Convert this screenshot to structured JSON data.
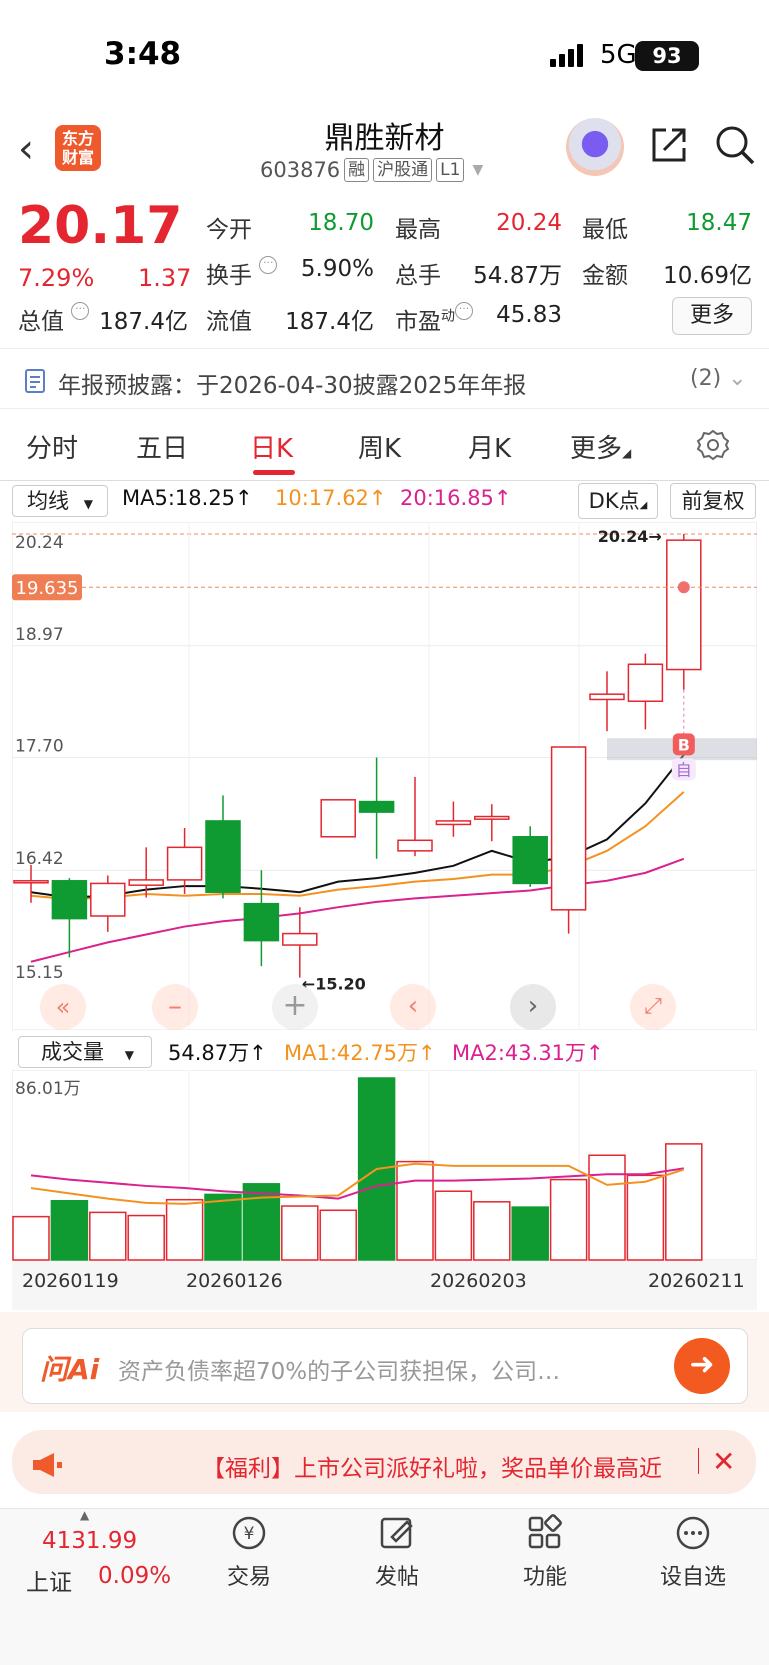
{
  "status": {
    "time": "3:48",
    "network": "5G",
    "battery": "93"
  },
  "header": {
    "logo_top": "东方",
    "logo_bottom": "财富",
    "name": "鼎胜新材",
    "code": "603876",
    "tags": [
      "融",
      "沪股通",
      "L1"
    ]
  },
  "quote": {
    "price": "20.17",
    "pct": "7.29%",
    "change": "1.37",
    "fields": [
      {
        "k": "今开",
        "v": "18.70",
        "c": "green"
      },
      {
        "k": "最高",
        "v": "20.24",
        "c": "red"
      },
      {
        "k": "最低",
        "v": "18.47",
        "c": "green"
      },
      {
        "k": "换手",
        "v": "5.90%",
        "c": "dark"
      },
      {
        "k": "总手",
        "v": "54.87万",
        "c": "dark"
      },
      {
        "k": "金额",
        "v": "10.69亿",
        "c": "dark"
      },
      {
        "k": "总值",
        "v": "187.4亿",
        "c": "dark"
      },
      {
        "k": "流值",
        "v": "187.4亿",
        "c": "dark"
      },
      {
        "k": "市盈",
        "v": "45.83",
        "c": "dark"
      }
    ],
    "pe_sup": "动",
    "more": "更多"
  },
  "notice": {
    "text": "年报预披露：于2026-04-30披露2025年年报",
    "count": "(2)"
  },
  "tabs": [
    "分时",
    "五日",
    "日K",
    "周K",
    "月K",
    "更多"
  ],
  "active_tab": 2,
  "ma_row": {
    "select": "均线",
    "ma5": "MA5:18.25↑",
    "ma10": "10:17.62↑",
    "ma20": "20:16.85↑",
    "dk": "DK点",
    "fq": "前复权"
  },
  "price_axis": [
    "20.24",
    "18.97",
    "17.70",
    "16.42",
    "15.15"
  ],
  "crosshair": "19.635",
  "high_label": "20.24→",
  "low_label": "←15.20",
  "b_label": "B",
  "self_label": "自",
  "vol_row": {
    "select": "成交量",
    "vol": "54.87万↑",
    "ma1": "MA1:42.75万↑",
    "ma2": "MA2:43.31万↑",
    "axis_max": "86.01万"
  },
  "dates": [
    "20260119",
    "20260126",
    "20260203",
    "20260211"
  ],
  "colors": {
    "up": "#e3262f",
    "down": "#0f9b32",
    "ma5": "#111111",
    "ma10": "#f39220",
    "ma20": "#d9218f"
  },
  "chart_data": {
    "type": "candlestick",
    "ylim": [
      15.15,
      20.24
    ],
    "candles": [
      {
        "o": 16.3,
        "c": 16.3,
        "h": 16.48,
        "l": 16.05
      },
      {
        "o": 16.3,
        "c": 15.87,
        "h": 16.33,
        "l": 15.43
      },
      {
        "o": 15.9,
        "c": 16.27,
        "h": 16.36,
        "l": 15.72
      },
      {
        "o": 16.25,
        "c": 16.31,
        "h": 16.68,
        "l": 16.11
      },
      {
        "o": 16.31,
        "c": 16.68,
        "h": 16.9,
        "l": 16.15
      },
      {
        "o": 16.98,
        "c": 16.17,
        "h": 17.27,
        "l": 16.1
      },
      {
        "o": 16.04,
        "c": 15.62,
        "h": 16.42,
        "l": 15.33
      },
      {
        "o": 15.57,
        "c": 15.7,
        "h": 16.0,
        "l": 15.2
      },
      {
        "o": 16.8,
        "c": 17.22,
        "h": 17.22,
        "l": 16.8
      },
      {
        "o": 17.2,
        "c": 17.08,
        "h": 17.7,
        "l": 16.55
      },
      {
        "o": 16.64,
        "c": 16.76,
        "h": 17.48,
        "l": 16.58
      },
      {
        "o": 16.94,
        "c": 16.98,
        "h": 17.2,
        "l": 16.8
      },
      {
        "o": 17.0,
        "c": 17.03,
        "h": 17.17,
        "l": 16.75
      },
      {
        "o": 16.8,
        "c": 16.27,
        "h": 16.92,
        "l": 16.23
      },
      {
        "o": 15.97,
        "c": 17.82,
        "h": 17.82,
        "l": 15.7
      },
      {
        "o": 18.36,
        "c": 18.42,
        "h": 18.68,
        "l": 18.0
      },
      {
        "o": 18.34,
        "c": 18.76,
        "h": 18.88,
        "l": 18.02
      },
      {
        "o": 18.7,
        "c": 20.17,
        "h": 20.24,
        "l": 18.47
      }
    ],
    "ma5": [
      16.17,
      16.11,
      16.13,
      16.2,
      16.24,
      16.24,
      16.21,
      16.17,
      16.29,
      16.33,
      16.39,
      16.47,
      16.64,
      16.51,
      16.57,
      16.77,
      17.18,
      17.73
    ],
    "ma10": [
      16.13,
      16.09,
      16.11,
      16.15,
      16.13,
      16.15,
      16.15,
      16.13,
      16.2,
      16.24,
      16.29,
      16.32,
      16.37,
      16.37,
      16.46,
      16.64,
      16.92,
      17.31
    ],
    "ma20": [
      15.38,
      15.49,
      15.6,
      15.69,
      15.78,
      15.84,
      15.88,
      15.93,
      16.0,
      16.06,
      16.1,
      16.13,
      16.16,
      16.19,
      16.25,
      16.3,
      16.39,
      16.55
    ],
    "volume": {
      "ylim": [
        0,
        86.01
      ],
      "values": [
        20.5,
        28.0,
        22.5,
        21.0,
        28.5,
        31.0,
        36.0,
        25.5,
        23.5,
        86.0,
        46.5,
        32.5,
        27.5,
        25.0,
        38.0,
        49.5,
        40.0,
        54.87
      ],
      "ma1": [
        34.0,
        31.5,
        29.0,
        27.0,
        26.5,
        28.0,
        29.5,
        30.0,
        30.5,
        43.0,
        45.5,
        44.5,
        44.5,
        44.5,
        44.5,
        35.5,
        37.0,
        42.75
      ],
      "ma2": [
        40.0,
        38.0,
        36.5,
        35.0,
        34.0,
        32.5,
        31.5,
        30.5,
        29.0,
        35.0,
        37.5,
        37.5,
        38.0,
        38.5,
        39.5,
        40.5,
        40.5,
        43.31
      ]
    }
  },
  "ai": {
    "logo": "问Ai",
    "placeholder": "资产负债率超70%的子公司获担保，公司…"
  },
  "promo": {
    "text": "【福利】上市公司派好礼啦，奖品单价最高近"
  },
  "nav": {
    "index_value": "4131.99",
    "index_name": "上证",
    "index_pct": "0.09%",
    "items": [
      "交易",
      "发帖",
      "功能",
      "设自选"
    ]
  }
}
